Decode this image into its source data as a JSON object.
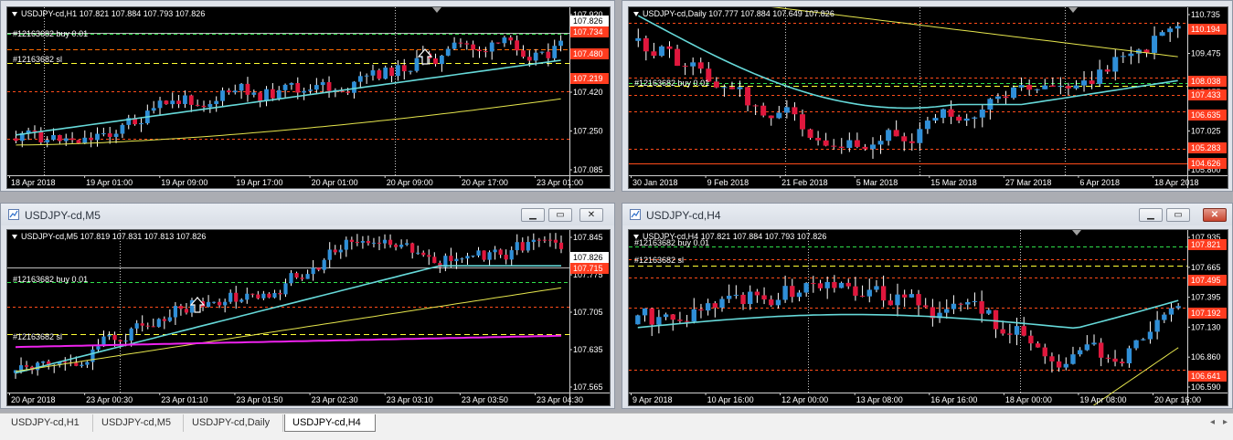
{
  "theme": {
    "bull": "#ffffff",
    "bear": "#ffffff",
    "bull_fill": "#2f8fd8",
    "bear_fill": "#e0173d",
    "ma_fast": "#66d9d9",
    "ma_slow": "#e6e64d",
    "ma_magenta": "#ee22ee",
    "grid": "#d7d7d7",
    "red_label": "#ff3c1f"
  },
  "windows": [
    {
      "id": "h1",
      "title": "",
      "info": "USDJPY-cd,H1  107.821 107.884 107.793 107.826",
      "price_ticks": [
        "107.920",
        "107.585",
        "107.420",
        "107.250",
        "107.085"
      ],
      "price_tags": [
        {
          "value": "107.826",
          "kind": "current"
        },
        {
          "value": "107.734",
          "kind": "red"
        },
        {
          "value": "107.480",
          "kind": "red"
        },
        {
          "value": "107.219",
          "kind": "red"
        }
      ],
      "order_labels": [
        "#12163682 buy 0.01",
        "#12163682 sl"
      ],
      "time_labels": [
        "18 Apr 2018",
        "19 Apr 01:00",
        "19 Apr 09:00",
        "19 Apr 17:00",
        "20 Apr 01:00",
        "20 Apr 09:00",
        "20 Apr 17:00",
        "23 Apr 01:00"
      ]
    },
    {
      "id": "daily",
      "title": "",
      "info": "USDJPY-cd,Daily  107.777 107.884 107.649 107.826",
      "price_ticks": [
        "110.735",
        "109.475",
        "108.255",
        "107.025",
        "105.800"
      ],
      "price_tags": [
        {
          "value": "110.194",
          "kind": "red"
        },
        {
          "value": "108.038",
          "kind": "red"
        },
        {
          "value": "107.433",
          "kind": "red"
        },
        {
          "value": "106.635",
          "kind": "red"
        },
        {
          "value": "105.283",
          "kind": "red"
        },
        {
          "value": "104.626",
          "kind": "red"
        }
      ],
      "order_labels": [
        "#12163682 buy 0.01"
      ],
      "time_labels": [
        "30 Jan 2018",
        "9 Feb 2018",
        "21 Feb 2018",
        "5 Mar 2018",
        "15 Mar 2018",
        "27 Mar 2018",
        "6 Apr 2018",
        "18 Apr 2018"
      ]
    },
    {
      "id": "m5",
      "title": "USDJPY-cd,M5",
      "info": "USDJPY-cd,M5  107.819 107.831 107.813 107.826",
      "price_ticks": [
        "107.845",
        "107.775",
        "107.705",
        "107.635",
        "107.565"
      ],
      "price_tags": [
        {
          "value": "107.826",
          "kind": "current"
        },
        {
          "value": "107.715",
          "kind": "red"
        }
      ],
      "order_labels": [
        "#12163682 buy 0.01",
        "#12163682 sl"
      ],
      "time_labels": [
        "20 Apr 2018",
        "23 Apr 00:30",
        "23 Apr 01:10",
        "23 Apr 01:50",
        "23 Apr 02:30",
        "23 Apr 03:10",
        "23 Apr 03:50",
        "23 Apr 04:30"
      ]
    },
    {
      "id": "h4",
      "title": "USDJPY-cd,H4",
      "info": "USDJPY-cd,H4  107.821 107.884 107.793 107.826",
      "price_ticks": [
        "107.935",
        "107.665",
        "107.395",
        "107.130",
        "106.860",
        "106.590"
      ],
      "price_tags": [
        {
          "value": "107.821",
          "kind": "red"
        },
        {
          "value": "107.495",
          "kind": "red"
        },
        {
          "value": "107.192",
          "kind": "red"
        },
        {
          "value": "106.641",
          "kind": "red"
        }
      ],
      "order_labels": [
        "#12163682 buy 0.01",
        "#12163682 sl"
      ],
      "time_labels": [
        "9 Apr 2018",
        "10 Apr 16:00",
        "12 Apr 00:00",
        "13 Apr 08:00",
        "16 Apr 16:00",
        "18 Apr 00:00",
        "19 Apr 08:00",
        "20 Apr 16:00"
      ]
    }
  ],
  "window_buttons": {
    "minimize": "▁",
    "maximize": "▭",
    "close": "✕"
  },
  "tabs": [
    "USDJPY-cd,H1",
    "USDJPY-cd,M5",
    "USDJPY-cd,Daily",
    "USDJPY-cd,H4"
  ],
  "active_tab": 3,
  "scroll_left": "◂",
  "scroll_right": "▸"
}
